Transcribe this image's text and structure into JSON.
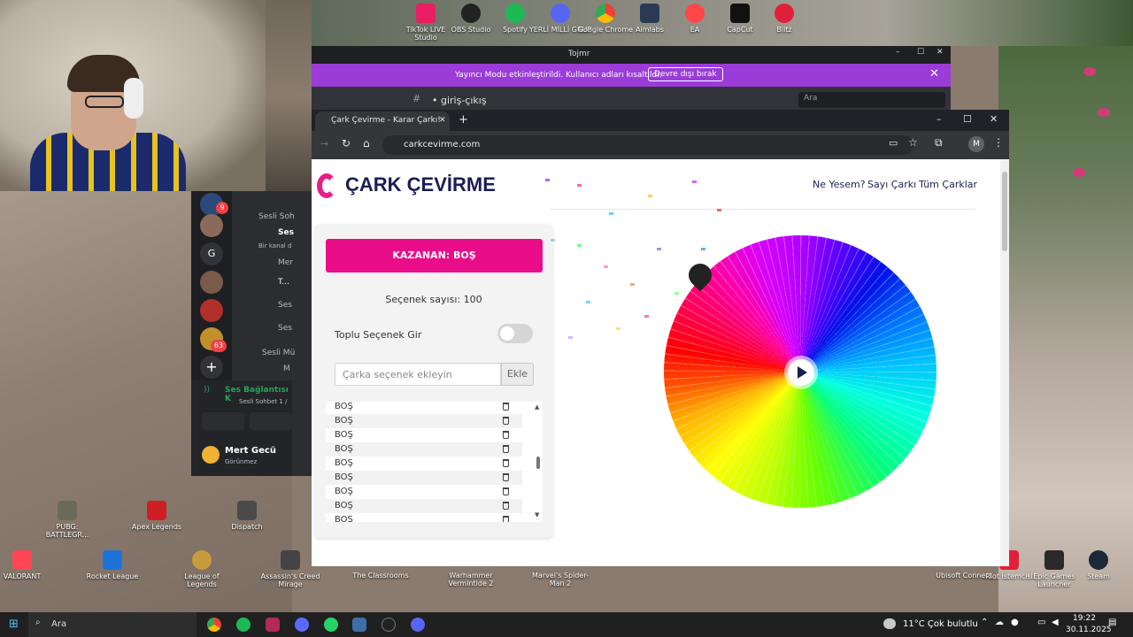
{
  "desktop": {
    "top_icons": [
      "TikTok LIVE Studio",
      "OBS Studio",
      "Spotify",
      "YERLİ MİLLİ GRUP",
      "Google Chrome",
      "Aimlabs",
      "EA",
      "CapCut",
      "Blitz"
    ],
    "left_icons": [
      "PUBG: BATTLEGR...",
      "Apex Legends",
      "Dispatch"
    ],
    "bottom_icons": [
      "VALORANT",
      "Rocket League",
      "League of Legends",
      "Assassin's Creed Mirage",
      "The Classrooms",
      "Warhammer Vermintide 2",
      "Marvel's Spider-Man 2"
    ],
    "right_icons": [
      "Ubisoft Connect",
      "Riot İstemcisi",
      "Epic Games Launcher",
      "Steam"
    ]
  },
  "discord": {
    "title": "Tojmr",
    "banner": "Yayıncı Modu etkinleştirildi. Kullanıcı adları kısaltıldı.",
    "banner_button": "Devre dışı bırak",
    "channel": "• giriş-çıkış",
    "search_placeholder": "Ara",
    "sidebar": {
      "voice1": "Sesli Soh",
      "voice1_active": "Ses",
      "note": "Bir kanal d",
      "m1": "Mer",
      "m2": "T...",
      "voice2": "Ses",
      "voice3": "Ses",
      "voice4": "Sesli Mü",
      "voice5": "M",
      "connection": "Ses Bağlantısı K",
      "connection_sub": "Sesli Sohbet 1 /",
      "user": "Mert Gecü",
      "user_status": "Görünmez",
      "guild_g": "G",
      "badge_9": "9",
      "badge_63": "63"
    }
  },
  "browser": {
    "tab_title": "Çark Çevirme - Karar Çarkı!",
    "url": "carkcevirme.com",
    "profile": "M"
  },
  "page": {
    "logo": "ÇARK ÇEVİRME",
    "nav": [
      "Ne Yesem?",
      "Sayı Çarkı",
      "Tüm Çarklar"
    ],
    "winner": "KAZANAN: BOŞ",
    "count_label": "Seçenek sayısı: 100",
    "bulk_label": "Toplu Seçenek Gir",
    "bulk_on": false,
    "input_placeholder": "Çarka seçenek ekleyin",
    "add_button": "Ekle",
    "options": [
      "BOŞ",
      "BOŞ",
      "BOŞ",
      "BOŞ",
      "BOŞ",
      "BOŞ",
      "BOŞ",
      "BOŞ",
      "BOŞ"
    ]
  },
  "taskbar": {
    "search": "Ara",
    "weather": "11°C  Çok bulutlu",
    "time": "19:22",
    "date": "30.11.2025"
  },
  "colors": {
    "brand_pink": "#ea0d8a",
    "brand_navy": "#1a1e55",
    "discord_banner": "#9b3bd8"
  }
}
